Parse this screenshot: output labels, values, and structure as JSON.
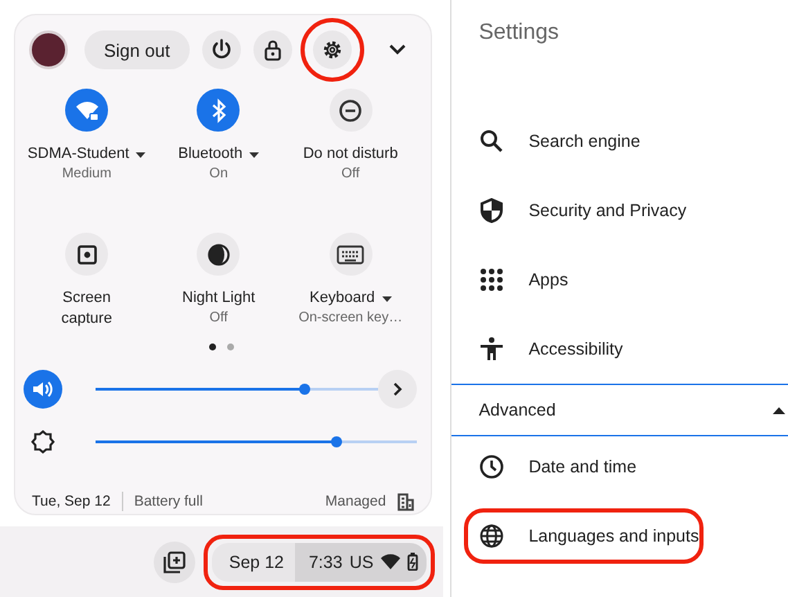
{
  "quick_settings": {
    "header": {
      "sign_out": "Sign out",
      "buttons": [
        {
          "kind": "power",
          "circled": false
        },
        {
          "kind": "lock",
          "circled": false
        },
        {
          "kind": "settings",
          "circled": true
        }
      ],
      "expanded": true
    },
    "tiles": [
      {
        "kind": "wifi",
        "label": "SDMA-Student",
        "sublabel": "Medium",
        "on": true,
        "has_menu": true
      },
      {
        "kind": "bluetooth",
        "label": "Bluetooth",
        "sublabel": "On",
        "on": true,
        "has_menu": true
      },
      {
        "kind": "dnd",
        "label": "Do not disturb",
        "sublabel": "Off",
        "on": false,
        "has_menu": false
      },
      {
        "kind": "capture",
        "label": "Screen capture",
        "on": false,
        "has_menu": false
      },
      {
        "kind": "night",
        "label": "Night Light",
        "sublabel": "Off",
        "on": false,
        "has_menu": false
      },
      {
        "kind": "keyboard",
        "label": "Keyboard",
        "sublabel": "On-screen key…",
        "on": false,
        "has_menu": true
      }
    ],
    "pages": [
      {
        "selected": true
      },
      {
        "selected": false
      }
    ],
    "sliders": [
      {
        "kind": "volume",
        "level": 0.74,
        "active": true,
        "has_more": true
      },
      {
        "kind": "brightness",
        "level": 0.75,
        "active": false,
        "has_more": false
      }
    ],
    "footer": {
      "date": "Tue, Sep 12",
      "battery": "Battery full",
      "managed": "Managed"
    }
  },
  "shelf": {
    "date": "Sep 12",
    "time": "7:33",
    "ime": "US",
    "circled": true
  },
  "settings": {
    "title": "Settings",
    "items": [
      {
        "kind": "search",
        "label": "Search engine",
        "circled": false
      },
      {
        "kind": "shield",
        "label": "Security and Privacy",
        "circled": false
      },
      {
        "kind": "apps",
        "label": "Apps",
        "circled": false
      },
      {
        "kind": "accessibility",
        "label": "Accessibility",
        "circled": false
      }
    ],
    "advanced": {
      "label": "Advanced",
      "expanded": true
    },
    "advanced_items": [
      {
        "kind": "clock",
        "label": "Date and time",
        "circled": false
      },
      {
        "kind": "globe",
        "label": "Languages and inputs",
        "circled": true
      }
    ]
  }
}
